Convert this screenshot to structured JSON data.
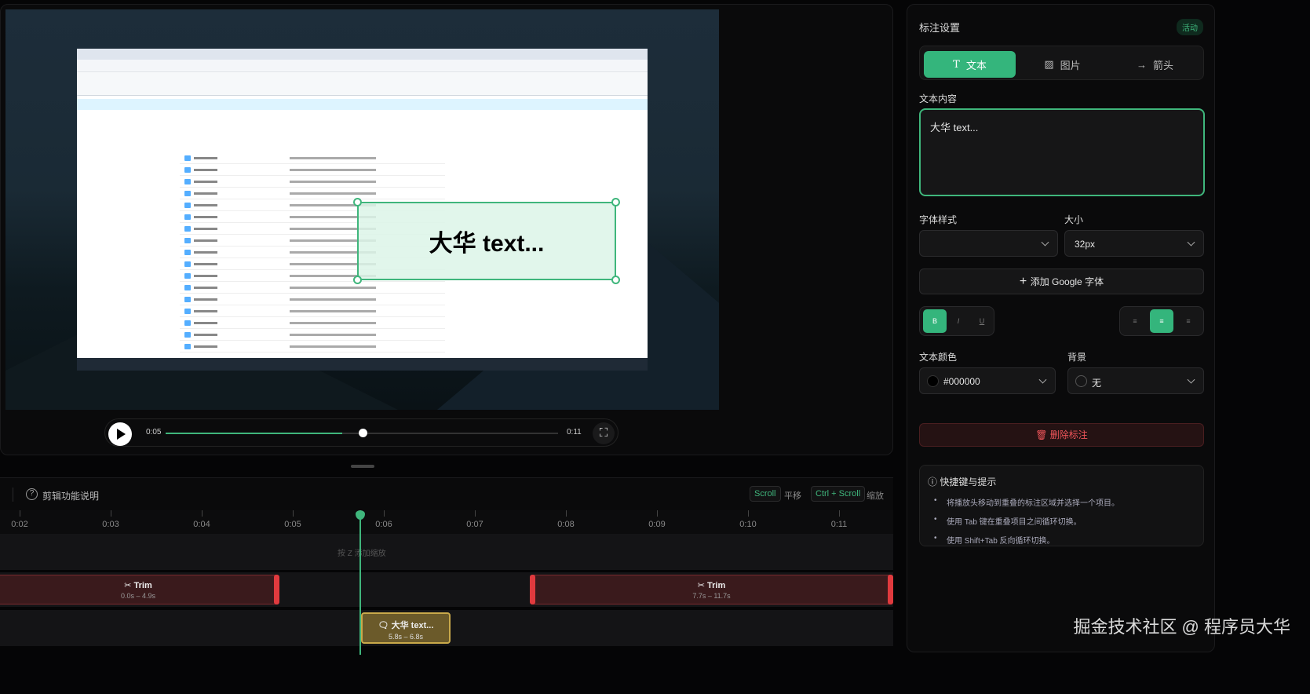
{
  "preview": {
    "annotation_text": "大华 text...",
    "current_time": "0:05",
    "duration": "0:11",
    "progress": 0.45
  },
  "timeline": {
    "help_label": "剪辑功能说明",
    "shortcuts": [
      {
        "key": "Scroll",
        "label": "平移"
      },
      {
        "key": "Ctrl + Scroll",
        "label": "缩放"
      }
    ],
    "ticks": [
      "0:02",
      "0:03",
      "0:04",
      "0:05",
      "0:06",
      "0:07",
      "0:08",
      "0:09",
      "0:10",
      "0:11"
    ],
    "zoom_hint": "按 Z 添加缩放",
    "trims": [
      {
        "label": "Trim",
        "range": "0.0s – 4.9s"
      },
      {
        "label": "Trim",
        "range": "7.7s – 11.7s"
      }
    ],
    "annotation_clip": {
      "label": "大华 text...",
      "range": "5.8s – 6.8s"
    }
  },
  "panel": {
    "title": "标注设置",
    "status": "活动",
    "tabs": [
      {
        "label": "文本",
        "icon": "text-icon"
      },
      {
        "label": "图片",
        "icon": "image-icon"
      },
      {
        "label": "箭头",
        "icon": "arrow-icon"
      }
    ],
    "content_label": "文本内容",
    "content_value": "大华 text...",
    "font_style_label": "字体样式",
    "font_style_value": "",
    "size_label": "大小",
    "size_value": "32px",
    "add_font": "添加 Google 字体",
    "format": [
      "B",
      "I",
      "U"
    ],
    "text_color_label": "文本颜色",
    "text_color": "#000000",
    "bg_label": "背景",
    "bg_value": "无",
    "delete": "删除标注",
    "tips_title": "快捷键与提示",
    "tips": [
      "将播放头移动到重叠的标注区域并选择一个项目。",
      "使用 Tab 键在重叠项目之间循环切换。",
      "使用 Shift+Tab 反向循环切换。"
    ]
  },
  "watermark": "掘金技术社区 @ 程序员大华"
}
